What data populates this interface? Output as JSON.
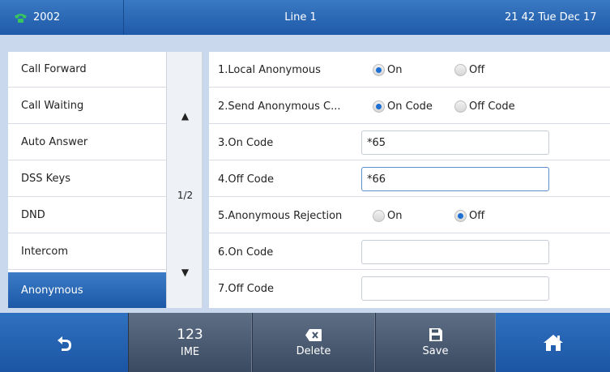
{
  "header": {
    "extension": "2002",
    "line": "Line 1",
    "datetime": "21 42 Tue Dec 17"
  },
  "sidebar": {
    "items": [
      {
        "label": "Call Forward"
      },
      {
        "label": "Call Waiting"
      },
      {
        "label": "Auto Answer"
      },
      {
        "label": "DSS Keys"
      },
      {
        "label": "DND"
      },
      {
        "label": "Intercom"
      },
      {
        "label": "Anonymous",
        "active": true
      }
    ]
  },
  "pager": {
    "up": "▲",
    "page": "1/2",
    "down": "▼"
  },
  "rows": {
    "r1": {
      "label": "1.Local Anonymous",
      "opt_on": "On",
      "opt_off": "Off",
      "selected": "On"
    },
    "r2": {
      "label": "2.Send Anonymous C...",
      "opt_on": "On Code",
      "opt_off": "Off Code",
      "selected": "On Code"
    },
    "r3": {
      "label": "3.On Code",
      "value": "*65"
    },
    "r4": {
      "label": "4.Off Code",
      "value": "*66"
    },
    "r5": {
      "label": "5.Anonymous Rejection",
      "opt_on": "On",
      "opt_off": "Off",
      "selected": "Off"
    },
    "r6": {
      "label": "6.On Code",
      "value": ""
    },
    "r7": {
      "label": "7.Off Code",
      "value": ""
    }
  },
  "footer": {
    "back_icon": "back-icon",
    "ime_top": "123",
    "ime_label": "IME",
    "delete_label": "Delete",
    "save_label": "Save",
    "home_icon": "home-icon"
  },
  "colors": {
    "header": "#2a69b6",
    "accent": "#1e6fd4",
    "content_bg": "#c9d8ec"
  }
}
